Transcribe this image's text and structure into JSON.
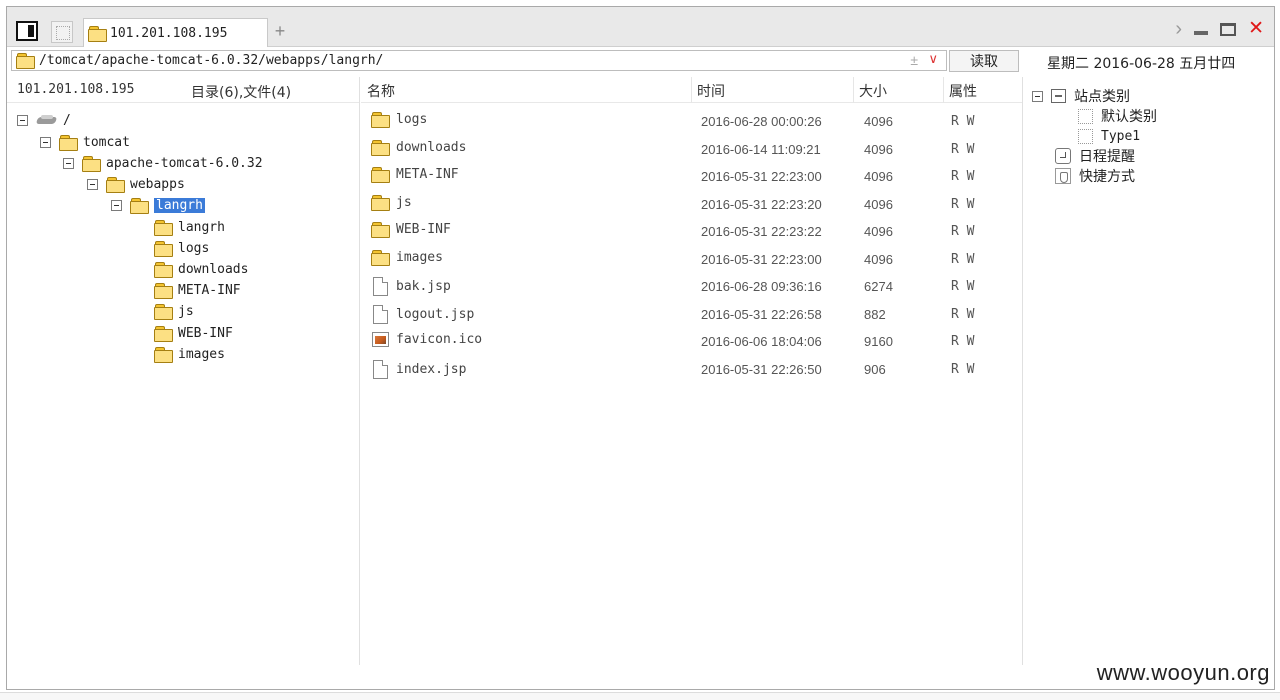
{
  "tab": {
    "title": "101.201.108.195",
    "add_label": "+"
  },
  "window_controls": {
    "nav": "›",
    "close": "✕"
  },
  "path": {
    "value": "/tomcat/apache-tomcat-6.0.32/webapps/langrh/",
    "plusminus": "±",
    "dropdown": "∨"
  },
  "read_button": "读取",
  "date_display": "星期二 2016-06-28 五月廿四",
  "left": {
    "host": "101.201.108.195",
    "counts": "目录(6),文件(4)",
    "tree": {
      "root": "/",
      "tomcat": "tomcat",
      "apache": "apache-tomcat-6.0.32",
      "webapps": "webapps",
      "langrh": "langrh",
      "children": [
        "langrh",
        "logs",
        "downloads",
        "META-INF",
        "js",
        "WEB-INF",
        "images"
      ]
    }
  },
  "columns": {
    "name": "名称",
    "time": "时间",
    "size": "大小",
    "attr": "属性"
  },
  "files": [
    {
      "type": "folder",
      "name": "logs",
      "time": "2016-06-28 00:00:26",
      "size": "4096",
      "attr": "R W"
    },
    {
      "type": "folder",
      "name": "downloads",
      "time": "2016-06-14 11:09:21",
      "size": "4096",
      "attr": "R W"
    },
    {
      "type": "folder",
      "name": "META-INF",
      "time": "2016-05-31 22:23:00",
      "size": "4096",
      "attr": "R W"
    },
    {
      "type": "folder",
      "name": "js",
      "time": "2016-05-31 22:23:20",
      "size": "4096",
      "attr": "R W"
    },
    {
      "type": "folder",
      "name": "WEB-INF",
      "time": "2016-05-31 22:23:22",
      "size": "4096",
      "attr": "R W"
    },
    {
      "type": "folder",
      "name": "images",
      "time": "2016-05-31 22:23:00",
      "size": "4096",
      "attr": "R W"
    },
    {
      "type": "file",
      "name": "bak.jsp",
      "time": "2016-06-28 09:36:16",
      "size": "6274",
      "attr": "R W"
    },
    {
      "type": "file",
      "name": "logout.jsp",
      "time": "2016-05-31 22:26:58",
      "size": "882",
      "attr": "R W"
    },
    {
      "type": "image",
      "name": "favicon.ico",
      "time": "2016-06-06 18:04:06",
      "size": "9160",
      "attr": "R W"
    },
    {
      "type": "file",
      "name": "index.jsp",
      "time": "2016-05-31 22:26:50",
      "size": "906",
      "attr": "R W"
    }
  ],
  "right": {
    "site_category": "站点类别",
    "default_category": "默认类别",
    "type1": "Type1",
    "schedule": "日程提醒",
    "shortcuts": "快捷方式"
  },
  "watermark": "www.wooyun.org"
}
